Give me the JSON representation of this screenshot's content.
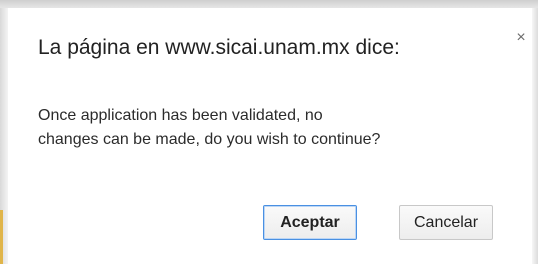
{
  "dialog": {
    "title": "La página en www.sicai.unam.mx dice:",
    "close_symbol": "×",
    "message_line1": "Once application has been validated, no",
    "message_line2": "changes can be made, do you wish to continue?",
    "accept_label": "Aceptar",
    "cancel_label": "Cancelar"
  },
  "icons": {
    "close": "close-icon"
  }
}
